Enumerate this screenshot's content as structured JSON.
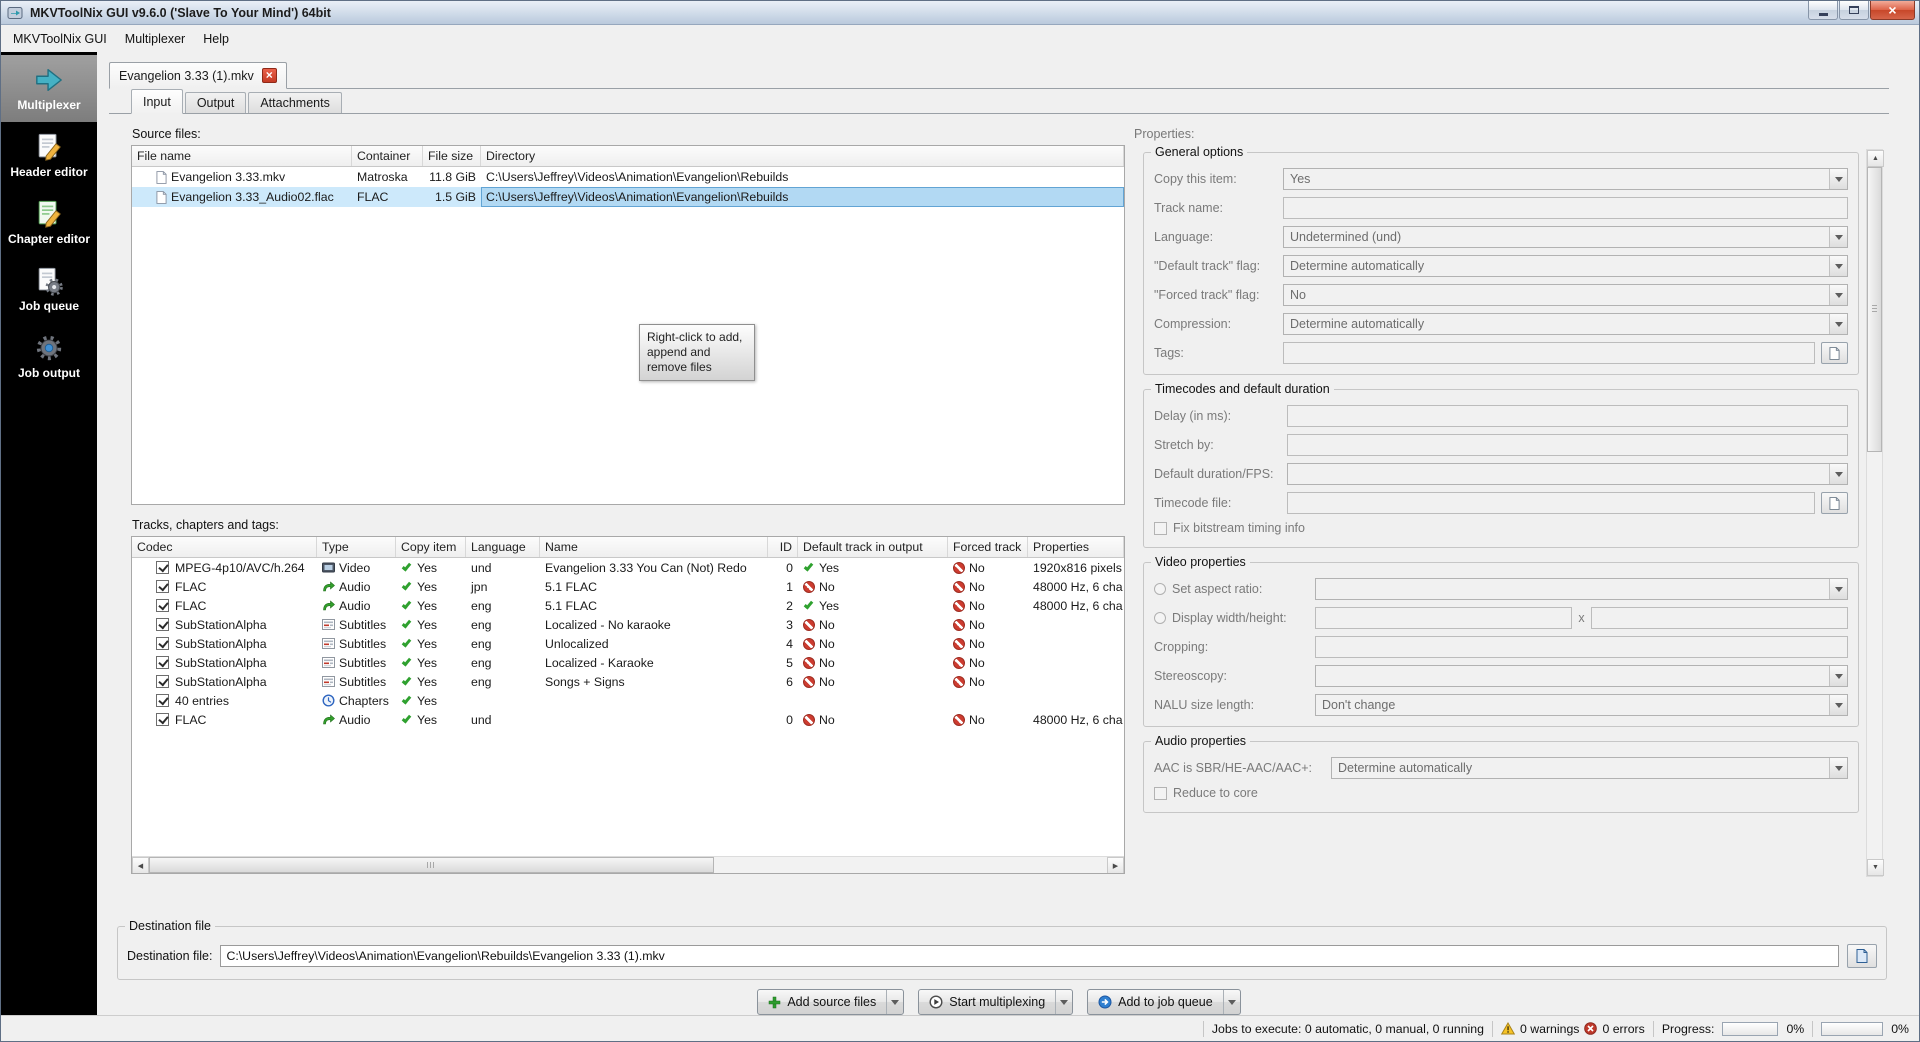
{
  "window": {
    "title": "MKVToolNix GUI v9.6.0 ('Slave To Your Mind') 64bit"
  },
  "menu": {
    "items": [
      "MKVToolNix GUI",
      "Multiplexer",
      "Help"
    ]
  },
  "sidebar": {
    "items": [
      {
        "label": "Multiplexer",
        "icon": "multiplexer-icon",
        "selected": true
      },
      {
        "label": "Header editor",
        "icon": "header-editor-icon",
        "selected": false
      },
      {
        "label": "Chapter editor",
        "icon": "chapter-editor-icon",
        "selected": false
      },
      {
        "label": "Job queue",
        "icon": "job-queue-icon",
        "selected": false
      },
      {
        "label": "Job output",
        "icon": "job-output-icon",
        "selected": false
      }
    ]
  },
  "doc_tab": {
    "label": "Evangelion 3.33 (1).mkv"
  },
  "subtabs": {
    "items": [
      "Input",
      "Output",
      "Attachments"
    ],
    "active": "Input"
  },
  "source_files": {
    "label": "Source files:",
    "columns": [
      "File name",
      "Container",
      "File size",
      "Directory"
    ],
    "rows": [
      {
        "name": "Evangelion 3.33.mkv",
        "container": "Matroska",
        "size": "11.8 GiB",
        "dir": "C:\\Users\\Jeffrey\\Videos\\Animation\\Evangelion\\Rebuilds",
        "selected": false
      },
      {
        "name": "Evangelion 3.33_Audio02.flac",
        "container": "FLAC",
        "size": "1.5 GiB",
        "dir": "C:\\Users\\Jeffrey\\Videos\\Animation\\Evangelion\\Rebuilds",
        "selected": true
      }
    ],
    "hint": "Right-click to add,\nappend and\nremove files"
  },
  "tracks": {
    "label": "Tracks, chapters and tags:",
    "columns": [
      "Codec",
      "Type",
      "Copy item",
      "Language",
      "Name",
      "ID",
      "Default track in output",
      "Forced track",
      "Properties"
    ],
    "rows": [
      {
        "codec": "MPEG-4p10/AVC/h.264",
        "type": "Video",
        "type_icon": "video-icon",
        "copy": "Yes",
        "lang": "und",
        "name": "Evangelion 3.33 You Can (Not) Redo",
        "id": "0",
        "default": "Yes",
        "forced": "No",
        "props": "1920x816 pixels"
      },
      {
        "codec": "FLAC",
        "type": "Audio",
        "type_icon": "audio-icon",
        "copy": "Yes",
        "lang": "jpn",
        "name": "5.1 FLAC",
        "id": "1",
        "default": "No",
        "forced": "No",
        "props": "48000 Hz, 6 cha"
      },
      {
        "codec": "FLAC",
        "type": "Audio",
        "type_icon": "audio-icon",
        "copy": "Yes",
        "lang": "eng",
        "name": "5.1 FLAC",
        "id": "2",
        "default": "Yes",
        "forced": "No",
        "props": "48000 Hz, 6 cha"
      },
      {
        "codec": "SubStationAlpha",
        "type": "Subtitles",
        "type_icon": "subtitles-icon",
        "copy": "Yes",
        "lang": "eng",
        "name": "Localized - No karaoke",
        "id": "3",
        "default": "No",
        "forced": "No",
        "props": ""
      },
      {
        "codec": "SubStationAlpha",
        "type": "Subtitles",
        "type_icon": "subtitles-icon",
        "copy": "Yes",
        "lang": "eng",
        "name": "Unlocalized",
        "id": "4",
        "default": "No",
        "forced": "No",
        "props": ""
      },
      {
        "codec": "SubStationAlpha",
        "type": "Subtitles",
        "type_icon": "subtitles-icon",
        "copy": "Yes",
        "lang": "eng",
        "name": "Localized - Karaoke",
        "id": "5",
        "default": "No",
        "forced": "No",
        "props": ""
      },
      {
        "codec": "SubStationAlpha",
        "type": "Subtitles",
        "type_icon": "subtitles-icon",
        "copy": "Yes",
        "lang": "eng",
        "name": "Songs + Signs",
        "id": "6",
        "default": "No",
        "forced": "No",
        "props": ""
      },
      {
        "codec": "40 entries",
        "type": "Chapters",
        "type_icon": "chapters-icon",
        "copy": "Yes",
        "lang": "",
        "name": "",
        "id": "",
        "default": "",
        "forced": "",
        "props": ""
      },
      {
        "codec": "FLAC",
        "type": "Audio",
        "type_icon": "audio-icon",
        "copy": "Yes",
        "lang": "und",
        "name": "",
        "id": "0",
        "default": "No",
        "forced": "No",
        "props": "48000 Hz, 6 cha"
      }
    ]
  },
  "properties": {
    "label": "Properties:",
    "general": {
      "title": "General options",
      "copy_item": {
        "label": "Copy this item:",
        "value": "Yes"
      },
      "track_name": {
        "label": "Track name:",
        "value": ""
      },
      "language": {
        "label": "Language:",
        "value": "Undetermined (und)"
      },
      "default_flag": {
        "label": "\"Default track\" flag:",
        "value": "Determine automatically"
      },
      "forced_flag": {
        "label": "\"Forced track\" flag:",
        "value": "No"
      },
      "compression": {
        "label": "Compression:",
        "value": "Determine automatically"
      },
      "tags": {
        "label": "Tags:",
        "value": ""
      }
    },
    "timecodes": {
      "title": "Timecodes and default duration",
      "delay": {
        "label": "Delay (in ms):",
        "value": ""
      },
      "stretch": {
        "label": "Stretch by:",
        "value": ""
      },
      "duration": {
        "label": "Default duration/FPS:",
        "value": ""
      },
      "timecode_file": {
        "label": "Timecode file:",
        "value": ""
      },
      "fix_timing": {
        "label": "Fix bitstream timing info",
        "checked": false
      }
    },
    "video": {
      "title": "Video properties",
      "aspect": {
        "label": "Set aspect ratio:",
        "value": ""
      },
      "display": {
        "label": "Display width/height:",
        "value_w": "",
        "value_h": "",
        "separator": "x"
      },
      "cropping": {
        "label": "Cropping:",
        "value": ""
      },
      "stereoscopy": {
        "label": "Stereoscopy:",
        "value": ""
      },
      "nalu": {
        "label": "NALU size length:",
        "value": "Don't change"
      }
    },
    "audio": {
      "title": "Audio properties",
      "aac": {
        "label": "AAC is SBR/HE-AAC/AAC+:",
        "value": "Determine automatically"
      },
      "reduce": {
        "label": "Reduce to core",
        "checked": false
      }
    }
  },
  "destination": {
    "group_title": "Destination file",
    "label": "Destination file:",
    "value": "C:\\Users\\Jeffrey\\Videos\\Animation\\Evangelion\\Rebuilds\\Evangelion 3.33 (1).mkv"
  },
  "actions": {
    "add_source": "Add source files",
    "start_multiplexing": "Start multiplexing",
    "add_to_queue": "Add to job queue"
  },
  "status_bar": {
    "jobs": "Jobs to execute: 0 automatic, 0 manual, 0 running",
    "warnings": "0 warnings",
    "errors": "0 errors",
    "progress_label": "Progress:",
    "progress1_percent": "0%",
    "progress2_percent": "0%",
    "progress1_value": 0,
    "progress2_value": 0
  },
  "icons": {
    "app-icon": "mkvtoolnix arrow logo",
    "minimize-icon": "bar",
    "maximize-icon": "rectangle",
    "close-icon": "×",
    "tab-close-icon": "× on red",
    "multiplexer-icon": "teal right arrow",
    "header-editor-icon": "document with pencil",
    "chapter-editor-icon": "green document with pencil",
    "job-queue-icon": "document with gear",
    "job-output-icon": "gear with blue center",
    "file-icon": "document sheet",
    "video-icon": "screen",
    "audio-icon": "green curved arrow",
    "subtitles-icon": "text lines",
    "chapters-icon": "blue clock",
    "yes-icon": "green check",
    "no-icon": "red slashed circle",
    "browse-icon": "document sheet",
    "add-icon": "green plus",
    "start-icon": "play circle",
    "queue-icon": "blue circle arrow",
    "warning-icon": "yellow triangle",
    "error-icon": "red circle x",
    "chevron-down-icon": "▾"
  },
  "colors": {
    "selection": "#cde9fb",
    "check_green": "#2fa12f",
    "no_red": "#cd3c30",
    "titlebar": "#cfdbe9",
    "sidebar_bg": "#000000",
    "warning_yellow": "#f7c325",
    "error_red": "#c0392b"
  }
}
